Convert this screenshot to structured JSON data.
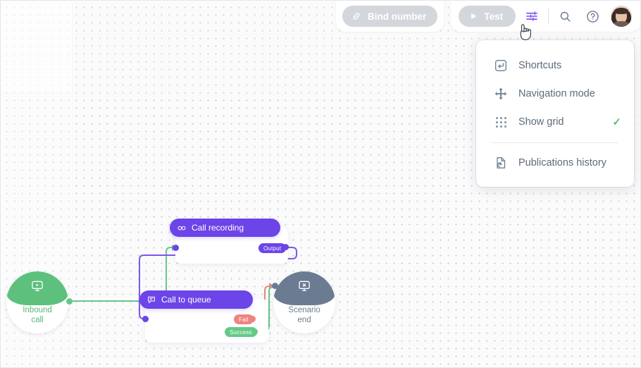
{
  "toolbar": {
    "bind_number_label": "Bind number",
    "bind_number_icon": "link-icon",
    "test_label": "Test",
    "test_icon": "play-icon",
    "settings_icon": "sliders-icon",
    "search_icon": "search-icon",
    "help_icon": "question-circle-icon",
    "avatar_alt": "user-avatar"
  },
  "menu": {
    "items": [
      {
        "label": "Shortcuts",
        "icon": "enter-key-icon",
        "checked": false
      },
      {
        "label": "Navigation mode",
        "icon": "move-arrows-icon",
        "checked": false
      },
      {
        "label": "Show grid",
        "icon": "dot-grid-icon",
        "checked": true,
        "check_glyph": "✓"
      },
      {
        "label": "Publications history",
        "icon": "document-history-icon",
        "checked": false
      }
    ]
  },
  "canvas": {
    "nodes": [
      {
        "id": "start",
        "type": "terminator",
        "label_line1": "Inbound",
        "label_line2": "call",
        "icon": "play-monitor-icon",
        "color": "#5ec07d"
      },
      {
        "id": "recording",
        "type": "block",
        "title": "Call recording",
        "icon": "recording-icon",
        "color": "#6c45e8"
      },
      {
        "id": "queue",
        "type": "block",
        "title": "Call to queue",
        "icon": "queue-icon",
        "color": "#6c45e8"
      },
      {
        "id": "end",
        "type": "terminator",
        "label_line1": "Scenario",
        "label_line2": "end",
        "icon": "stop-monitor-icon",
        "color": "#6b7b91"
      }
    ],
    "tags": [
      {
        "id": "output",
        "label": "Output",
        "color": "#6c45e8"
      },
      {
        "id": "fail",
        "label": "Fail",
        "color": "#f0837f"
      },
      {
        "id": "success",
        "label": "Success",
        "color": "#64c987"
      }
    ]
  },
  "cursor": {
    "icon": "pointing-hand-cursor"
  }
}
